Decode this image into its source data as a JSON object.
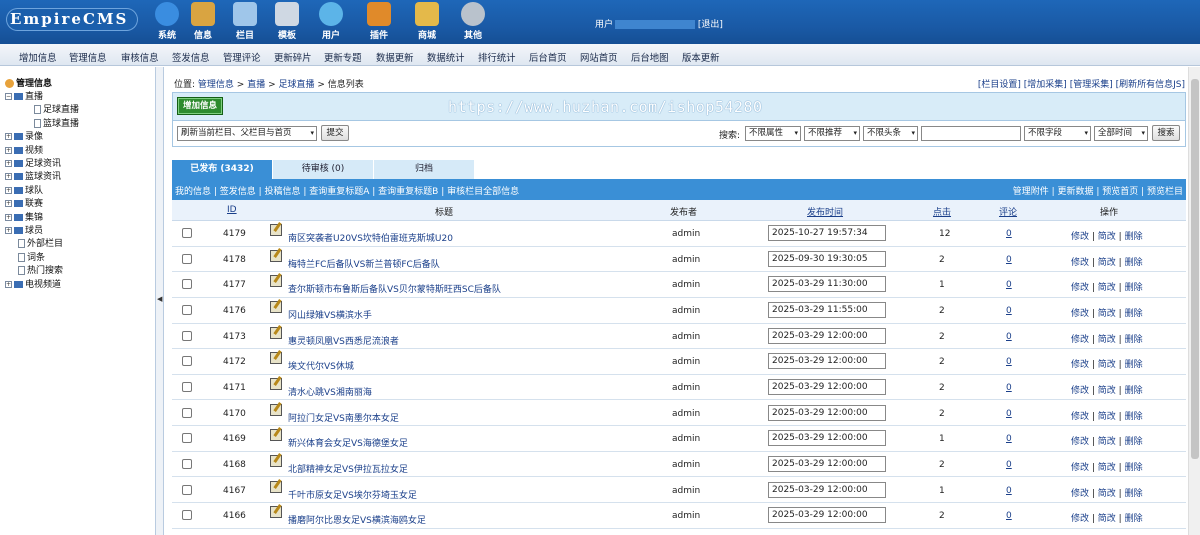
{
  "header": {
    "logo": "EmpireCMS",
    "nav": [
      {
        "label": "系统",
        "icon": "globe-icon",
        "color": "#3a8de0"
      },
      {
        "label": "信息",
        "icon": "document-edit-icon",
        "color": "#d9a441"
      },
      {
        "label": "栏目",
        "icon": "folder-icon",
        "color": "#9fc6ea"
      },
      {
        "label": "模板",
        "icon": "template-window-icon",
        "color": "#cfd8e3"
      },
      {
        "label": "用户",
        "icon": "user-icon",
        "color": "#5cb4e8"
      },
      {
        "label": "插件",
        "icon": "tools-icon",
        "color": "#e08a2a"
      },
      {
        "label": "商城",
        "icon": "shop-card-icon",
        "color": "#e4b94a"
      },
      {
        "label": "其他",
        "icon": "gear-icon",
        "color": "#b9c2cc"
      }
    ],
    "user_label": "用户",
    "logout": "[退出]"
  },
  "menu": [
    "增加信息",
    "管理信息",
    "审核信息",
    "签发信息",
    "管理评论",
    "更新碎片",
    "更新专题",
    "数据更新",
    "数据统计",
    "排行统计",
    "后台首页",
    "网站首页",
    "后台地图",
    "版本更新"
  ],
  "tree": {
    "root": "管理信息",
    "items": [
      {
        "label": "直播",
        "type": "open"
      },
      {
        "label": "足球直播",
        "type": "leaf"
      },
      {
        "label": "篮球直播",
        "type": "leaf"
      },
      {
        "label": "录像",
        "type": "closed"
      },
      {
        "label": "视频",
        "type": "closed"
      },
      {
        "label": "足球资讯",
        "type": "closed"
      },
      {
        "label": "篮球资讯",
        "type": "closed"
      },
      {
        "label": "球队",
        "type": "closed"
      },
      {
        "label": "联赛",
        "type": "closed"
      },
      {
        "label": "集锦",
        "type": "closed"
      },
      {
        "label": "球员",
        "type": "closed"
      },
      {
        "label": "外部栏目",
        "type": "file"
      },
      {
        "label": "词条",
        "type": "file"
      },
      {
        "label": "热门搜索",
        "type": "file"
      },
      {
        "label": "电视频道",
        "type": "closed"
      }
    ]
  },
  "breadcrumb": {
    "prefix": "位置:",
    "parts": [
      "管理信息",
      "直播",
      "足球直播",
      "信息列表"
    ],
    "sep": ">"
  },
  "toplinks": [
    "[栏目设置]",
    "[增加采集]",
    "[管理采集]",
    "[刷新所有信息JS]"
  ],
  "panel": {
    "add_button": "增加信息",
    "watermark": "https://www.huzhan.com/ishop54280",
    "refresh_select": "刷新当前栏目、父栏目与首页",
    "submit": "提交",
    "search_label": "搜索:",
    "filters": [
      "不限属性",
      "不限推荐",
      "不限头条"
    ],
    "field_select": "不限字段",
    "time_select": "全部时间",
    "search_button": "搜索"
  },
  "tabs": [
    {
      "label": "已发布 (3432)",
      "active": true
    },
    {
      "label": "待审核 (0)",
      "active": false
    },
    {
      "label": "归档",
      "active": false
    }
  ],
  "listbar": {
    "left": "我的信息 | 签发信息 | 投稿信息 | 查询重复标题A | 查询重复标题B | 审核栏目全部信息",
    "right": "管理附件 | 更新数据 | 预览首页 | 预览栏目"
  },
  "table": {
    "columns": [
      "ID",
      "标题",
      "发布者",
      "发布时间",
      "点击",
      "评论",
      "操作"
    ],
    "rows": [
      {
        "id": "4179",
        "title": "南区突袭者U20VS坎特伯雷班克斯城U20",
        "author": "admin",
        "time": "2025-10-27 19:57:34",
        "clicks": "12",
        "comments": "0"
      },
      {
        "id": "4178",
        "title": "梅特兰FC后备队VS新兰普顿FC后备队",
        "author": "admin",
        "time": "2025-09-30 19:30:05",
        "clicks": "2",
        "comments": "0"
      },
      {
        "id": "4177",
        "title": "查尔斯顿市布鲁斯后备队VS贝尔蒙特斯旺西SC后备队",
        "author": "admin",
        "time": "2025-03-29 11:30:00",
        "clicks": "1",
        "comments": "0"
      },
      {
        "id": "4176",
        "title": "冈山绿雉VS横滨水手",
        "author": "admin",
        "time": "2025-03-29 11:55:00",
        "clicks": "2",
        "comments": "0"
      },
      {
        "id": "4173",
        "title": "惠灵顿凤凰VS西悉尼流浪者",
        "author": "admin",
        "time": "2025-03-29 12:00:00",
        "clicks": "2",
        "comments": "0"
      },
      {
        "id": "4172",
        "title": "埃文代尔VS休城",
        "author": "admin",
        "time": "2025-03-29 12:00:00",
        "clicks": "2",
        "comments": "0"
      },
      {
        "id": "4171",
        "title": "清水心跳VS湘南丽海",
        "author": "admin",
        "time": "2025-03-29 12:00:00",
        "clicks": "2",
        "comments": "0"
      },
      {
        "id": "4170",
        "title": "阿拉门女足VS南墨尔本女足",
        "author": "admin",
        "time": "2025-03-29 12:00:00",
        "clicks": "2",
        "comments": "0"
      },
      {
        "id": "4169",
        "title": "新兴体育会女足VS海德堡女足",
        "author": "admin",
        "time": "2025-03-29 12:00:00",
        "clicks": "1",
        "comments": "0"
      },
      {
        "id": "4168",
        "title": "北部精神女足VS伊拉瓦拉女足",
        "author": "admin",
        "time": "2025-03-29 12:00:00",
        "clicks": "2",
        "comments": "0"
      },
      {
        "id": "4167",
        "title": "千叶市原女足VS埃尔芬埼玉女足",
        "author": "admin",
        "time": "2025-03-29 12:00:00",
        "clicks": "1",
        "comments": "0"
      },
      {
        "id": "4166",
        "title": "播磨阿尔比恩女足VS横滨海鸥女足",
        "author": "admin",
        "time": "2025-03-29 12:00:00",
        "clicks": "2",
        "comments": "0"
      }
    ],
    "actions": [
      "修改",
      "简改",
      "删除"
    ]
  }
}
